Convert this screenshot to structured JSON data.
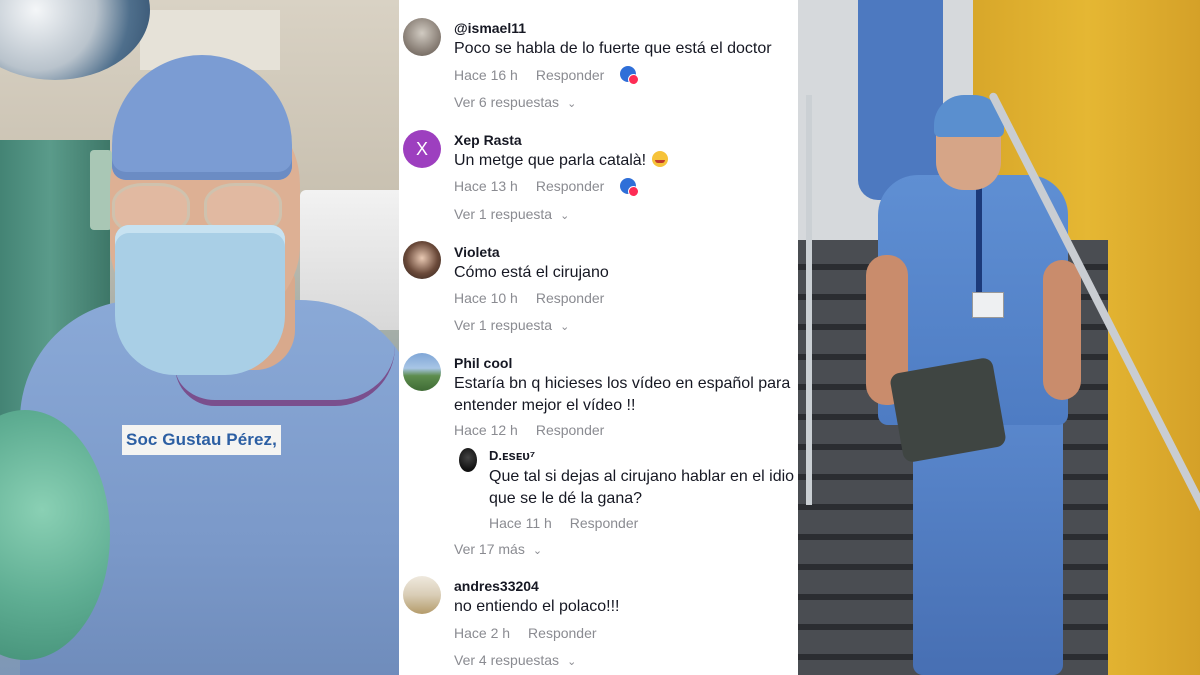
{
  "left_photo": {
    "caption": "Soc Gustau Pérez,"
  },
  "comments": [
    {
      "username": "@ismael11",
      "text": "Poco se habla de lo fuerte que está el doctor",
      "time": "Hace 16 h",
      "reply_label": "Responder",
      "view_replies": "Ver 6 respuestas"
    },
    {
      "avatar_letter": "X",
      "username": "Xep Rasta",
      "text": "Un metge que parla català!",
      "time": "Hace 13 h",
      "reply_label": "Responder",
      "view_replies": "Ver 1 respuesta"
    },
    {
      "username": "Violeta",
      "text": "Cómo está el cirujano",
      "time": "Hace 10 h",
      "reply_label": "Responder",
      "view_replies": "Ver 1 respuesta"
    },
    {
      "username": "Phil cool",
      "text_line1": "Estaría bn q hicieses los vídeo en español para",
      "text_line2": "entender mejor el vídeo !!",
      "time": "Hace 12 h",
      "reply_label": "Responder",
      "reply": {
        "username": "D.ᴇsᴇᴜ⁷",
        "text_line1": "Que tal si dejas al cirujano hablar en el idio",
        "text_line2": "que se le dé la gana?",
        "time": "Hace 11 h",
        "reply_label": "Responder"
      },
      "view_replies": "Ver 17 más"
    },
    {
      "username": "andres33204",
      "text": "no entiendo el polaco!!!",
      "time": "Hace 2 h",
      "reply_label": "Responder",
      "view_replies": "Ver 4 respuestas"
    }
  ],
  "icons": {
    "chevron": "chevron-down-icon",
    "creator_liked": "creator-liked-icon",
    "emoji": "smiling-face-with-hearts"
  },
  "colors": {
    "caption_text": "#2c5fa3",
    "meta_text": "#8a8b91",
    "avatar_letter_bg": "#9d3fbf"
  }
}
